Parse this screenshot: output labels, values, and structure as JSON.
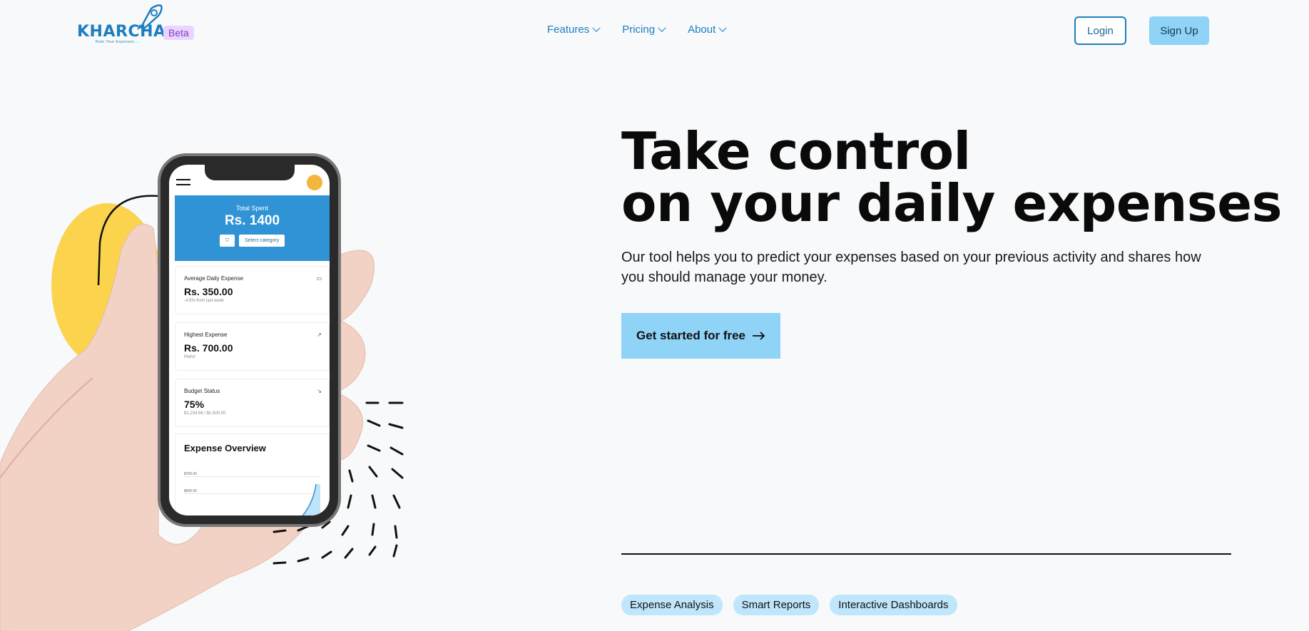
{
  "brand": {
    "name": "KHARCHA",
    "tagline": "Rate Your Expenses.....",
    "badge": "Beta"
  },
  "nav": {
    "items": [
      {
        "label": "Features"
      },
      {
        "label": "Pricing"
      },
      {
        "label": "About"
      }
    ]
  },
  "auth": {
    "login": "Login",
    "signup": "Sign Up"
  },
  "hero": {
    "title_line1": "Take control",
    "title_line2": "on your daily expenses",
    "subtitle": "Our tool helps you to predict your expenses based on your previous activity and shares how you should manage your money.",
    "cta": "Get started for free",
    "cta_icon": "arrow-right-icon"
  },
  "tags": [
    "Expense Analysis",
    "Smart Reports",
    "Interactive Dashboards"
  ],
  "phone": {
    "total_label": "Total Spent",
    "total_value": "Rs. 1400",
    "filter_icon": "filter-icon",
    "select_label": "Select category",
    "cards": [
      {
        "label": "Average Daily Expense",
        "value": "Rs. 350.00",
        "sub": "-4.5% from last week",
        "icon": "card-icon"
      },
      {
        "label": "Highest Expense",
        "value": "Rs. 700.00",
        "sub": "Petrol",
        "icon": "trend-up-icon"
      },
      {
        "label": "Budget Status",
        "value": "75%",
        "sub": "$1,234.56 / $1,500.00",
        "icon": "trend-down-icon"
      }
    ],
    "overview_title": "Expense Overview",
    "overview_ticks": [
      "$700.00",
      "$600.00"
    ]
  },
  "colors": {
    "primary": "#1d7fbf",
    "accent": "#8fd3f7",
    "beta_bg": "#e9d5ff",
    "phone_header": "#2f93d6",
    "blob": "#fcd34d"
  }
}
